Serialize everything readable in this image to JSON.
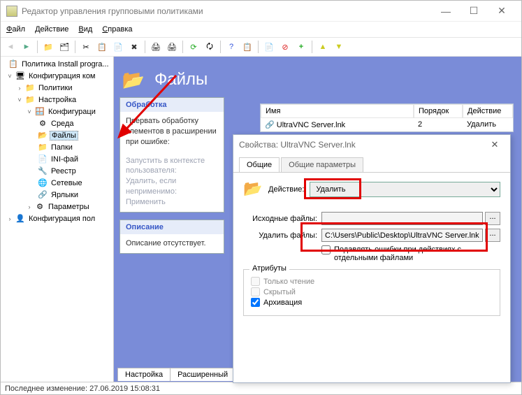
{
  "window": {
    "title": "Редактор управления групповыми политиками"
  },
  "menu": {
    "file": "Файл",
    "action": "Действие",
    "view": "Вид",
    "help": "Справка"
  },
  "tree": {
    "root": "Политика Install progra...",
    "compConfig": "Конфигурация ком",
    "policies": "Политики",
    "settings": "Настройка",
    "configWin": "Конфигураци",
    "env": "Среда",
    "files": "Файлы",
    "folders": "Папки",
    "ini": "INI-фай",
    "registry": "Реестр",
    "network": "Сетевые",
    "shortcuts": "Ярлыки",
    "params": "Параметры",
    "userConfig": "Конфигурация пол"
  },
  "pane": {
    "heading": "Файлы",
    "processingTitle": "Обработка",
    "processingText": "Прервать обработку элементов в расширении при ошибке:",
    "processingGray": "Запустить в контексте пользователя:\nУдалить, если неприменимо:\nПрименить",
    "descTitle": "Описание",
    "descBody": "Описание отсутствует."
  },
  "grid": {
    "head": {
      "name": "Имя",
      "order": "Порядок",
      "action": "Действие"
    },
    "row": {
      "name": "UltraVNC Server.lnk",
      "order": "2",
      "action": "Удалить"
    }
  },
  "tabs": {
    "settings": "Настройка",
    "extended": "Расширенный"
  },
  "status": {
    "text": "Последнее изменение: 27.06.2019 15:08:31"
  },
  "dialog": {
    "title": "Свойства: UltraVNC Server.lnk",
    "tabGeneral": "Общие",
    "tabShared": "Общие параметры",
    "actionLabel": "Действие:",
    "actionValue": "Удалить",
    "srcLabel": "Исходные файлы:",
    "srcValue": "",
    "delLabel": "Удалить файлы:",
    "delValue": "C:\\Users\\Public\\Desktop\\UltraVNC Server.lnk",
    "suppressLabel": "Подавлять ошибки при действиях с отдельными файлами",
    "attrsLegend": "Атрибуты",
    "readonly": "Только чтение",
    "hidden": "Скрытый",
    "archive": "Архивация",
    "browse": "..."
  }
}
